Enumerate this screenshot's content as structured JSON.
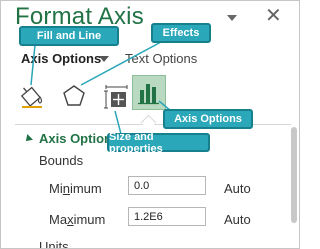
{
  "pane": {
    "title": "Format Axis",
    "close_symbol": "✕"
  },
  "tabs": {
    "axis_options": "Axis Options",
    "text_options": "Text Options"
  },
  "icons": [
    "fill-and-line-icon",
    "effects-icon",
    "size-and-properties-icon",
    "axis-options-icon"
  ],
  "callouts": {
    "fill_and_line": "Fill and Line",
    "effects": "Effects",
    "size_and_properties": "Size and properties",
    "axis_options": "Axis Options"
  },
  "section": {
    "title": "Axis Options",
    "bounds_label": "Bounds",
    "minimum": {
      "pre": "Mi",
      "ul": "n",
      "post": "imum",
      "value": "0.0",
      "auto": "Auto"
    },
    "maximum": {
      "pre": "Ma",
      "ul": "x",
      "post": "imum",
      "value": "1.2E6",
      "auto": "Auto"
    },
    "units_label": "Units"
  },
  "colors": {
    "accent_green": "#217346",
    "callout_teal": "#2aa7b9",
    "callout_border": "#17808f",
    "selected_tab_bg": "#b9d9c0"
  }
}
